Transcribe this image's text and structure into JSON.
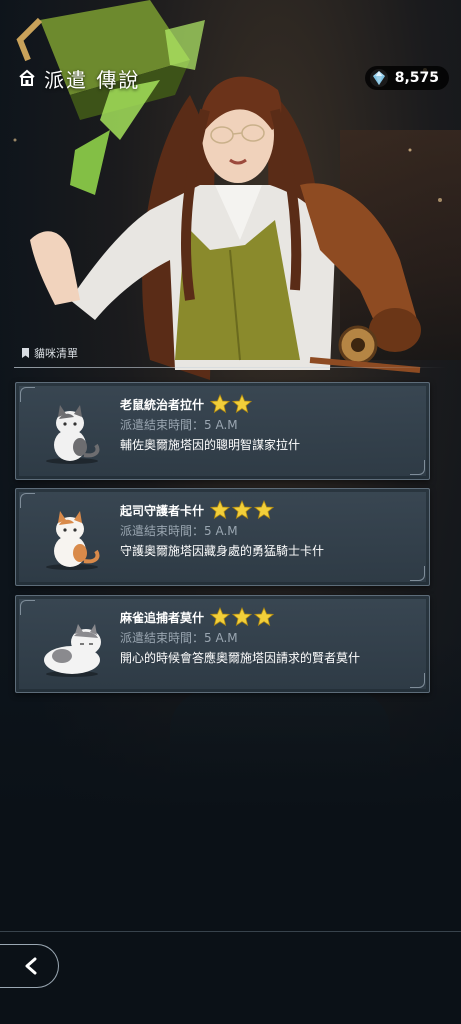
{
  "header": {
    "title": "派遣 傳說",
    "home_icon": "home-icon"
  },
  "currency": {
    "icon": "gem-icon",
    "value": "8,575"
  },
  "section": {
    "label": "貓咪清單",
    "icon": "bookmark-icon"
  },
  "cats": [
    {
      "name": "老鼠統治者拉什",
      "stars": 2,
      "time": "派遣結束時間：5 A.M",
      "desc": "輔佐奧爾施塔因的聰明智謀家拉什",
      "cat_colors": {
        "body": "#f1f1f1",
        "patch": "#6d6d70"
      }
    },
    {
      "name": "起司守護者卡什",
      "stars": 3,
      "time": "派遣結束時間：5 A.M",
      "desc": "守護奧爾施塔因藏身處的勇猛騎士卡什",
      "cat_colors": {
        "body": "#f7f4f0",
        "patch": "#d98a4a"
      }
    },
    {
      "name": "麻雀追捕者莫什",
      "stars": 3,
      "time": "派遣結束時間：5 A.M",
      "desc": "開心的時候會答應奧爾施塔因請求的賢者莫什",
      "cat_colors": {
        "body": "#f3f3f3",
        "patch": "#8a8a8e"
      }
    }
  ],
  "navigation": {
    "back_icon": "chevron-left-icon"
  },
  "colors": {
    "star": "#f2cf3a",
    "card_bg": "#3a4854",
    "accent_green": "#8fd24a"
  }
}
